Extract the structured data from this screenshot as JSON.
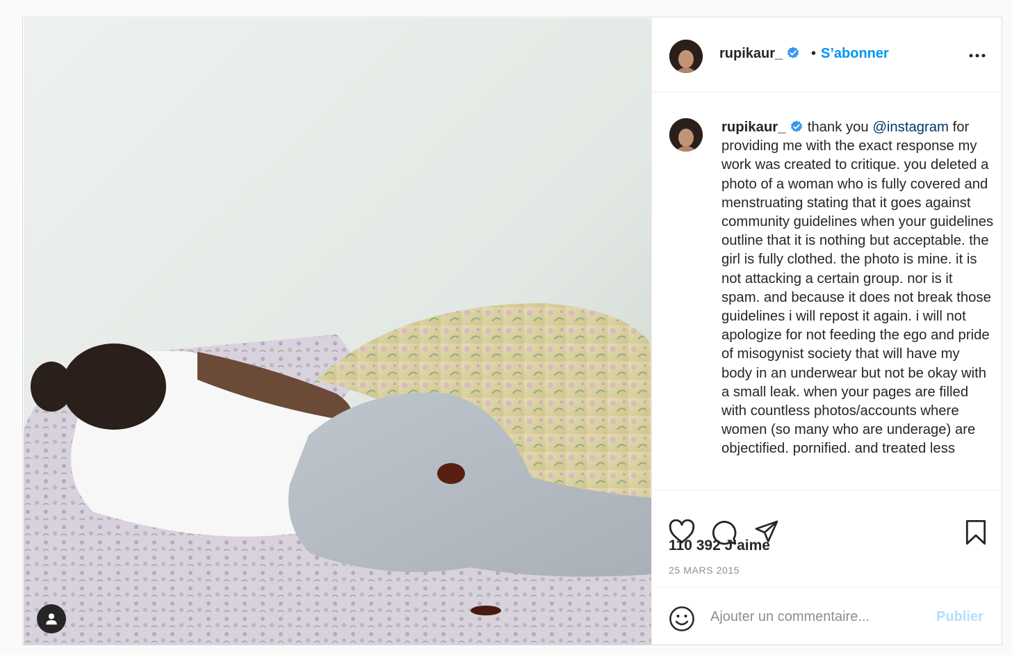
{
  "post": {
    "photo_alt": "",
    "user_tag_icon": "user-icon"
  },
  "header": {
    "username": "rupikaur_",
    "verified_icon": "verified-badge-icon",
    "separator": "•",
    "follow_label": "S’abonner",
    "more_icon": "more-horizontal-icon"
  },
  "caption": {
    "username": "rupikaur_",
    "text_before_mention": "thank you ",
    "mention": "@instagram",
    "text_after_mention": " for providing me with the exact response my work was created to critique. you deleted a photo of a woman who is fully covered and menstruating stating that it goes against community guidelines when your guidelines outline that it is nothing but acceptable. the girl is fully clothed. the photo is mine. it is not attacking a certain group. nor is it spam. and because it does not break those guidelines i will repost it again. i will not apologize for not feeding the ego and pride of misogynist society that will have my body in an underwear but not be okay with a small leak. when your pages are filled with countless photos/accounts where women (so many who are underage) are objectified. pornified. and treated less"
  },
  "actions": {
    "like_icon": "heart-icon",
    "comment_icon": "comment-icon",
    "share_icon": "send-icon",
    "save_icon": "bookmark-icon",
    "likes_text": "110 392 J’aime",
    "date_text": "25 MARS 2015"
  },
  "comment": {
    "emoji_icon": "emoji-icon",
    "placeholder": "Ajouter un commentaire...",
    "publish_label": "Publier",
    "publish_color": "#b2dffc"
  },
  "colors": {
    "accent": "#0095f6",
    "text": "#262626",
    "muted": "#8e8e8e",
    "mention": "#00376b"
  }
}
